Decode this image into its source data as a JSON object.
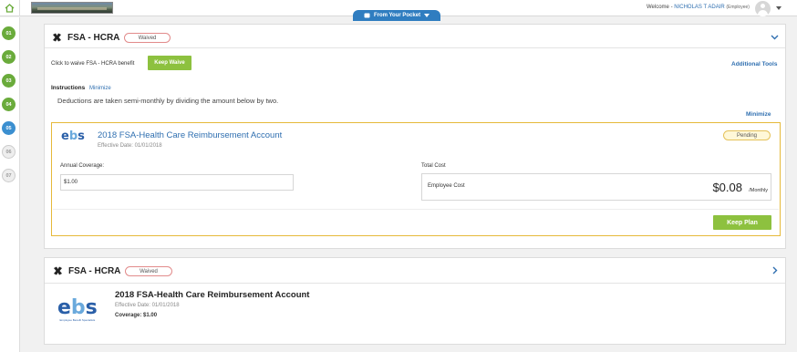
{
  "topbar": {
    "pocket_tab": "From Your Pocket",
    "welcome_prefix": "Welcome -",
    "user_name": "NICHOLAS T ADAIR",
    "user_role": "(Employee)"
  },
  "steps": [
    {
      "label": "01",
      "state": "done"
    },
    {
      "label": "02",
      "state": "done"
    },
    {
      "label": "03",
      "state": "done"
    },
    {
      "label": "04",
      "state": "done"
    },
    {
      "label": "05",
      "state": "current"
    },
    {
      "label": "06",
      "state": "todo"
    },
    {
      "label": "07",
      "state": "todo"
    }
  ],
  "section1": {
    "title": "FSA - HCRA",
    "status_badge": "Waived",
    "waive_prompt": "Click to waive FSA - HCRA benefit",
    "keep_waive_button": "Keep Waive",
    "additional_tools": "Additional Tools",
    "instructions_label": "Instructions",
    "instructions_toggle": "Minimize",
    "instructions_text": "Deductions are taken semi-monthly by dividing the amount below by two.",
    "plan_minimize": "Minimize",
    "plan": {
      "name": "2018 FSA-Health Care Reimbursement Account",
      "effective_date": "Effective Date: 01/01/2018",
      "status": "Pending",
      "annual_coverage_label": "Annual Coverage:",
      "annual_coverage_value": "$1.00",
      "total_cost_label": "Total Cost",
      "employee_cost_label": "Employee Cost",
      "employee_cost_value": "$0.08",
      "employee_cost_period": "/Monthly",
      "keep_plan_button": "Keep Plan"
    }
  },
  "section2": {
    "title": "FSA - HCRA",
    "status_badge": "Waived",
    "plan_name": "2018 FSA-Health Care Reimbursement Account",
    "effective_date": "Effective Date: 01/01/2018",
    "coverage": "Coverage: $1.00"
  },
  "logo": {
    "letters": [
      "e",
      "b",
      "s"
    ],
    "colors": [
      "#2a5fa8",
      "#6aa9dc",
      "#2a5fa8"
    ],
    "tagline": "Employee Benefit Specialists"
  },
  "colors": {
    "accent_blue": "#2f6fb0",
    "green_button": "#8dc13f",
    "step_done": "#6aab3b",
    "step_current": "#3b8fd0",
    "plan_border": "#e6b93a"
  }
}
